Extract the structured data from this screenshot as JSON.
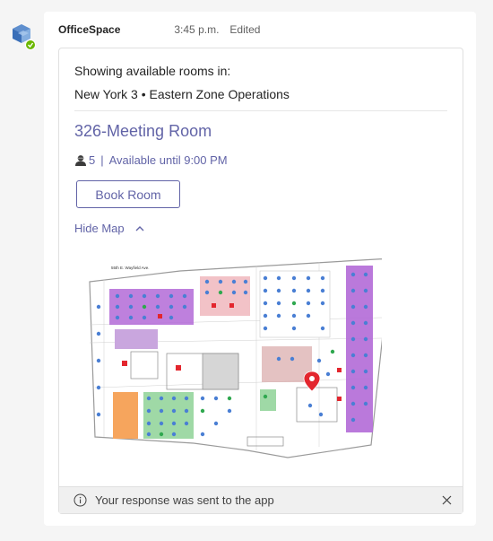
{
  "header": {
    "sender": "OfficeSpace",
    "time": "3:45 p.m.",
    "edited": "Edited"
  },
  "card": {
    "showing_label": "Showing available rooms in:",
    "location": "New York 3 • Eastern Zone Operations",
    "room_name": "326-Meeting Room",
    "capacity": "5",
    "separator": "|",
    "availability": "Available until 9:00 PM",
    "book_button": "Book Room",
    "hide_map": "Hide Map",
    "map_street_label": "55th E. Wayfield Ave."
  },
  "banner": {
    "text": "Your response was sent to the app"
  },
  "colors": {
    "accent": "#6264a7",
    "purple_zone": "#b36ad7",
    "pink_zone": "#f2c2c7",
    "green_zone": "#9fd9a6",
    "orange_zone": "#f6a55d",
    "pin": "#e3262e"
  }
}
